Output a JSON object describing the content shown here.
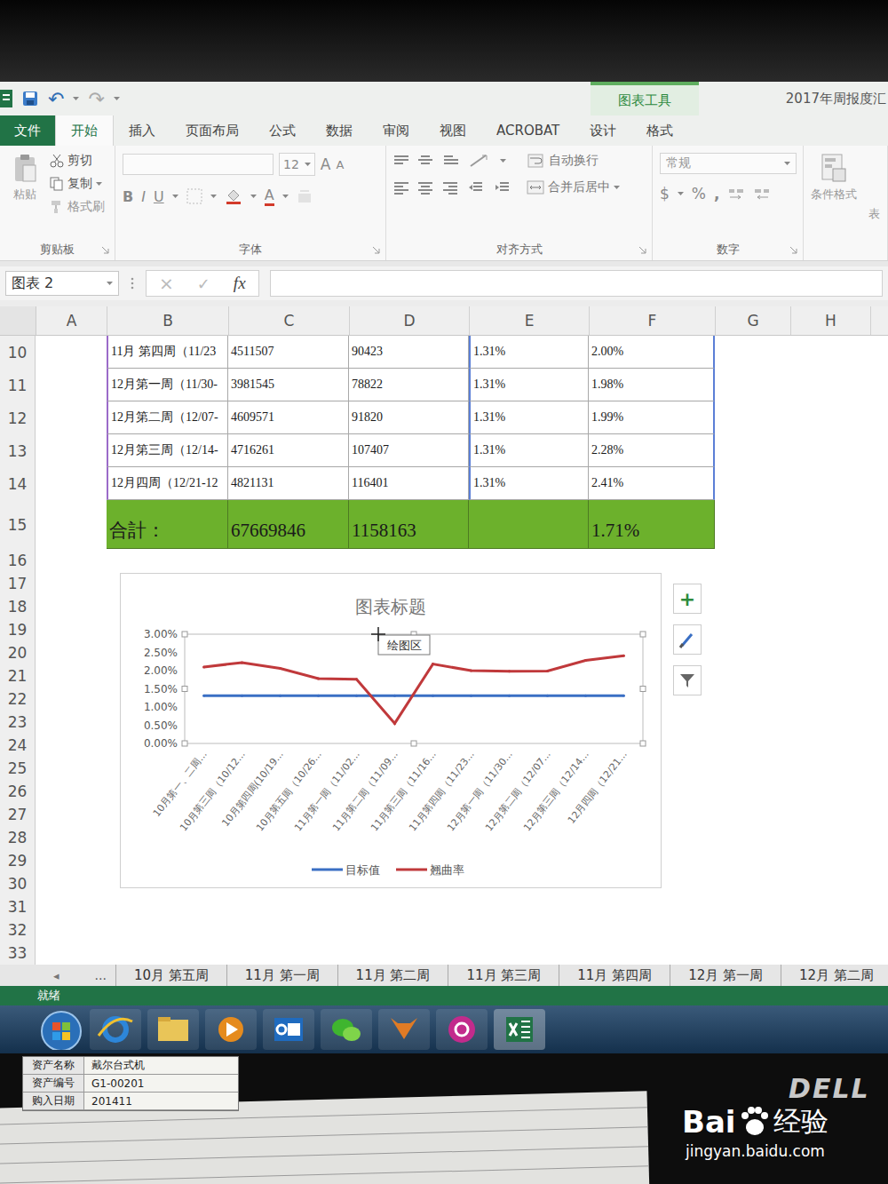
{
  "window": {
    "qat": [
      "↶",
      "↷"
    ],
    "context_tab": "图表工具",
    "title": "2017年周报度汇"
  },
  "tabs": [
    {
      "label": "文件",
      "kind": "file",
      "selected": false
    },
    {
      "label": "开始",
      "kind": "tab",
      "selected": true
    },
    {
      "label": "插入",
      "kind": "tab",
      "selected": false
    },
    {
      "label": "页面布局",
      "kind": "tab",
      "selected": false
    },
    {
      "label": "公式",
      "kind": "tab",
      "selected": false
    },
    {
      "label": "数据",
      "kind": "tab",
      "selected": false
    },
    {
      "label": "审阅",
      "kind": "tab",
      "selected": false
    },
    {
      "label": "视图",
      "kind": "tab",
      "selected": false
    },
    {
      "label": "ACROBAT",
      "kind": "tab",
      "selected": false
    },
    {
      "label": "设计",
      "kind": "tab",
      "selected": false
    },
    {
      "label": "格式",
      "kind": "tab",
      "selected": false
    }
  ],
  "ribbon": {
    "clipboard": {
      "paste": "粘贴",
      "cut": "剪切",
      "copy": "复制",
      "painter": "格式刷",
      "label": "剪贴板"
    },
    "font": {
      "size": "12",
      "grow": "A",
      "shrink": "A",
      "bold": "B",
      "italic": "I",
      "underline": "U",
      "color_a": "A",
      "label": "字体"
    },
    "alignment": {
      "wrap": "自动换行",
      "merge": "合并后居中",
      "label": "对齐方式"
    },
    "number": {
      "format": "常规",
      "currency": "$",
      "percent": "%",
      "comma": ",",
      "label": "数字"
    },
    "styles": {
      "conditional": "条件格式",
      "cut_label": "表"
    }
  },
  "formula_bar": {
    "name_box": "图表 2",
    "cancel": "×",
    "enter": "✓",
    "fx": "fx"
  },
  "sheet": {
    "columns": [
      "A",
      "B",
      "C",
      "D",
      "E",
      "F",
      "G",
      "H"
    ],
    "rows": [
      {
        "num": "10",
        "cells": [
          "11月 第四周（11/23",
          "4511507",
          "90423",
          "1.31%",
          "2.00%"
        ]
      },
      {
        "num": "11",
        "cells": [
          "12月第一周（11/30-",
          "3981545",
          "78822",
          "1.31%",
          "1.98%"
        ]
      },
      {
        "num": "12",
        "cells": [
          "12月第二周（12/07-",
          "4609571",
          "91820",
          "1.31%",
          "1.99%"
        ]
      },
      {
        "num": "13",
        "cells": [
          "12月第三周（12/14-",
          "4716261",
          "107407",
          "1.31%",
          "2.28%"
        ]
      },
      {
        "num": "14",
        "cells": [
          "12月四周（12/21-12",
          "4821131",
          "116401",
          "1.31%",
          "2.41%"
        ]
      }
    ],
    "total": {
      "num": "15",
      "cells": [
        "合計：",
        "67669846",
        "1158163",
        "",
        "1.71%"
      ]
    },
    "empty_rows": [
      "16",
      "17",
      "18",
      "19",
      "20",
      "21",
      "22",
      "23",
      "24",
      "25",
      "26",
      "27",
      "28",
      "29",
      "30",
      "31",
      "32",
      "33"
    ]
  },
  "chart": {
    "title": "图表标题",
    "y_ticks": [
      "3.00%",
      "2.50%",
      "2.00%",
      "1.50%",
      "1.00%",
      "0.50%",
      "0.00%"
    ],
    "y_max": 3,
    "categories": [
      "10月第一、二周...",
      "10月第三周（10/12...",
      "10月第四周(10/19...",
      "10月第五周（10/26...",
      "11月第一周（11/02...",
      "11月第二周（11/09...",
      "11月第三周（11/16...",
      "11月第四周（11/23...",
      "12月第一周（11/30...",
      "12月第二周（12/07...",
      "12月第三周（12/14...",
      "12月四周（12/21..."
    ],
    "series": [
      {
        "name": "目标值",
        "color": "#3a6fc4",
        "values": [
          1.31,
          1.31,
          1.31,
          1.31,
          1.31,
          1.31,
          1.31,
          1.31,
          1.31,
          1.31,
          1.31,
          1.31
        ]
      },
      {
        "name": "翘曲率",
        "color": "#c0393b",
        "values": [
          2.1,
          2.22,
          2.06,
          1.78,
          1.76,
          0.55,
          2.18,
          2.0,
          1.98,
          1.99,
          2.28,
          2.41
        ]
      }
    ],
    "tooltip": "绘图区",
    "plus": "+"
  },
  "sheet_tabs": {
    "nav": "◂",
    "more": "...",
    "tabs": [
      {
        "label": "10月 第五周",
        "selected": false
      },
      {
        "label": "11月 第一周",
        "selected": false
      },
      {
        "label": "11月 第二周",
        "selected": false
      },
      {
        "label": "11月 第三周",
        "selected": false
      },
      {
        "label": "11月 第四周",
        "selected": false
      },
      {
        "label": "12月 第一周",
        "selected": false
      },
      {
        "label": "12月 第二周",
        "selected": false
      }
    ]
  },
  "status_bar": "就绪",
  "sticker": [
    {
      "label": "资产名称",
      "value": "戴尔台式机"
    },
    {
      "label": "资产编号",
      "value": "G1-00201"
    },
    {
      "label": "购入日期",
      "value": "201411"
    }
  ],
  "monitor": {
    "brand": "DELL"
  },
  "watermark": {
    "brand_a": "Bai",
    "brand_b": "经验",
    "url": "jingyan.baidu.com"
  }
}
